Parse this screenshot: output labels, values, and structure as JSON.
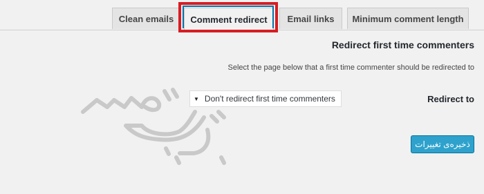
{
  "tabs": [
    {
      "label": "Clean emails",
      "active": false
    },
    {
      "label": "Comment redirect",
      "active": true
    },
    {
      "label": "Email links",
      "active": false
    },
    {
      "label": "Minimum comment length",
      "active": false
    }
  ],
  "highlight_color": "#d81c22",
  "section": {
    "title": "Redirect first time commenters",
    "description": "Select the page below that a first time commenter should be redirected to"
  },
  "redirect_field": {
    "label": "Redirect to",
    "selected": "Don't redirect first time commenters"
  },
  "save_button": {
    "label": "ذخیره‌ی تغییرات",
    "color": "#2ea2cc"
  },
  "watermark": {
    "icon": "watermark-logo",
    "color": "#cccccc"
  }
}
